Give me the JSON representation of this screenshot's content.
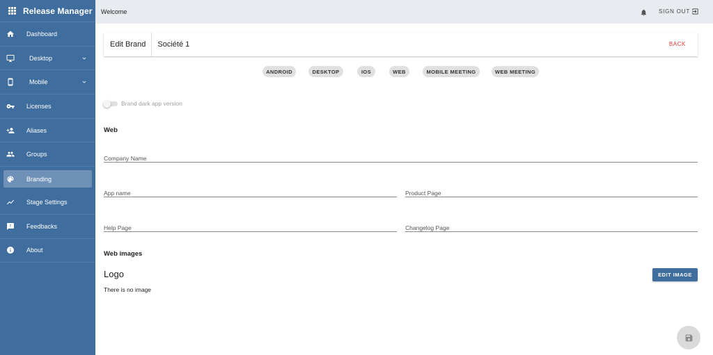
{
  "app": {
    "title": "Release Manager"
  },
  "sidebar": {
    "items": [
      {
        "label": "Dashboard",
        "icon": "home-icon"
      },
      {
        "label": "Desktop",
        "icon": "monitor-icon",
        "expandable": true
      },
      {
        "label": "Mobile",
        "icon": "phone-icon",
        "expandable": true
      },
      {
        "label": "Licenses",
        "icon": "key-icon"
      },
      {
        "label": "Aliases",
        "icon": "person-add-icon"
      },
      {
        "label": "Groups",
        "icon": "group-icon"
      },
      {
        "label": "Branding",
        "icon": "palette-icon",
        "active": true
      },
      {
        "label": "Stage Settings",
        "icon": "trending-icon"
      },
      {
        "label": "Feedbacks",
        "icon": "feedback-icon"
      },
      {
        "label": "About",
        "icon": "info-icon"
      }
    ]
  },
  "topbar": {
    "welcome": "Welcome",
    "signout": "SIGN OUT"
  },
  "editbar": {
    "title": "Edit Brand",
    "brand_name": "Société 1",
    "back": "BACK"
  },
  "platform_chips": [
    "ANDROID",
    "DESKTOP",
    "IOS",
    "WEB",
    "MOBILE MEETING",
    "WEB MEETING"
  ],
  "toggle": {
    "label": "Brand dark app version",
    "checked": false
  },
  "web_section": {
    "title": "Web",
    "fields": {
      "company_name": {
        "placeholder": "Company Name",
        "value": ""
      },
      "app_name": {
        "placeholder": "App name",
        "value": ""
      },
      "product_page": {
        "placeholder": "Product Page",
        "value": ""
      },
      "help_page": {
        "placeholder": "Help Page",
        "value": ""
      },
      "changelog_page": {
        "placeholder": "Changelog Page",
        "value": ""
      }
    }
  },
  "web_images": {
    "title": "Web images",
    "logo_title": "Logo",
    "no_image_text": "There is no image",
    "edit_button": "EDIT IMAGE"
  },
  "colors": {
    "sidebar": "#3f6d9e",
    "active_item": "#6f91b7",
    "topbar": "#e8ebf0",
    "danger": "#e53935"
  }
}
